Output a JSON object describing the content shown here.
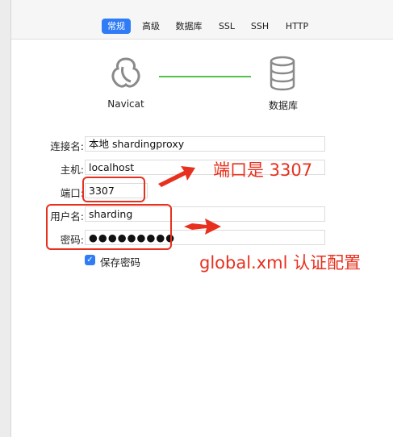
{
  "tabs": [
    {
      "label": "常规",
      "active": true
    },
    {
      "label": "高级",
      "active": false
    },
    {
      "label": "数据库",
      "active": false
    },
    {
      "label": "SSL",
      "active": false
    },
    {
      "label": "SSH",
      "active": false
    },
    {
      "label": "HTTP",
      "active": false
    }
  ],
  "diagram": {
    "client_label": "Navicat",
    "server_label": "数据库",
    "client_icon": "navicat-logo-icon",
    "server_icon": "database-icon",
    "link_color": "#52c24a"
  },
  "form": {
    "connection_name_label": "连接名:",
    "connection_name_value": "本地 shardingproxy",
    "host_label": "主机:",
    "host_value": "localhost",
    "port_label": "端口:",
    "port_value": "3307",
    "user_label": "用户名:",
    "user_value": "sharding",
    "password_label": "密码:",
    "password_value": "●●●●●●●●●",
    "save_password_label": "保存密码",
    "save_password_checked": true
  },
  "annotations": {
    "port_note": "端口是 3307",
    "auth_note": "global.xml 认证配置",
    "color": "#e8301e"
  }
}
